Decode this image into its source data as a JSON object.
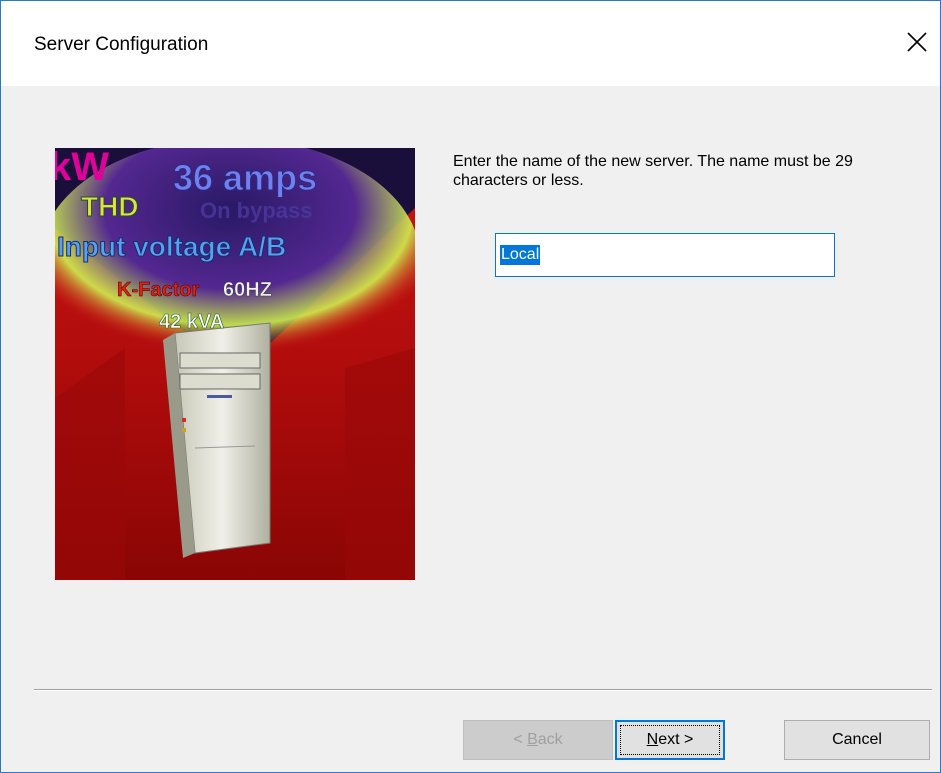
{
  "window": {
    "title": "Server Configuration",
    "close_label": "Close"
  },
  "image": {
    "description_icon": "server-tower-illustration",
    "texts": {
      "kw": "kW",
      "amps": "36 amps",
      "thd": "THD",
      "on_bypass": "On bypass",
      "input_voltage": "Input voltage A/B",
      "k_factor": "K-Factor",
      "hz": "60HZ",
      "kva": "42 kVA"
    }
  },
  "form": {
    "instruction": "Enter the name of the new server. The name must be 29 characters or less.",
    "server_name_value": "Local"
  },
  "buttons": {
    "back_prefix": "< ",
    "back_mnemonic": "B",
    "back_rest": "ack",
    "next_mnemonic": "N",
    "next_rest": "ext >",
    "cancel": "Cancel"
  },
  "colors": {
    "accent": "#0078d7",
    "window_border": "#2b79c9",
    "dialog_bg": "#f0f0f0"
  }
}
